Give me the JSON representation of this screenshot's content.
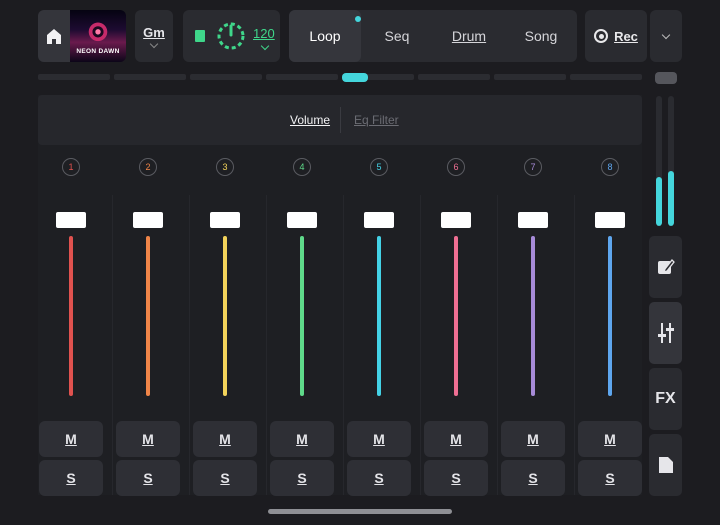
{
  "topbar": {
    "album_art_text": "NEON DAWN",
    "key_label": "Gm",
    "tempo": "120",
    "modes": [
      {
        "label": "Loop",
        "active": true
      },
      {
        "label": "Seq",
        "active": false
      },
      {
        "label": "Drum",
        "active": false
      },
      {
        "label": "Song",
        "active": false
      }
    ],
    "rec_label": "Rec"
  },
  "panel": {
    "tabs": [
      {
        "label": "Volume",
        "active": true
      },
      {
        "label": "Eq Filter",
        "active": false
      }
    ]
  },
  "channels": [
    {
      "number": "1",
      "color": "#e0524f",
      "mute_label": "M",
      "solo_label": "S"
    },
    {
      "number": "2",
      "color": "#f08548",
      "mute_label": "M",
      "solo_label": "S"
    },
    {
      "number": "3",
      "color": "#f3d35a",
      "mute_label": "M",
      "solo_label": "S"
    },
    {
      "number": "4",
      "color": "#5fd98a",
      "mute_label": "M",
      "solo_label": "S"
    },
    {
      "number": "5",
      "color": "#44d2e6",
      "mute_label": "M",
      "solo_label": "S"
    },
    {
      "number": "6",
      "color": "#ef6f93",
      "mute_label": "M",
      "solo_label": "S"
    },
    {
      "number": "7",
      "color": "#a78bd8",
      "mute_label": "M",
      "solo_label": "S"
    },
    {
      "number": "8",
      "color": "#5ea6ee",
      "mute_label": "M",
      "solo_label": "S"
    }
  ],
  "sidebar": {
    "fx_label": "FX",
    "meter_levels": [
      0.38,
      0.42
    ]
  },
  "colors": {
    "accent": "#44d6dc",
    "transport_green": "#3fd68a"
  },
  "icons": {
    "home": "home-icon",
    "record": "record-icon",
    "edit": "edit-icon",
    "mixer": "mixer-sliders-icon",
    "folder": "folder-icon"
  }
}
